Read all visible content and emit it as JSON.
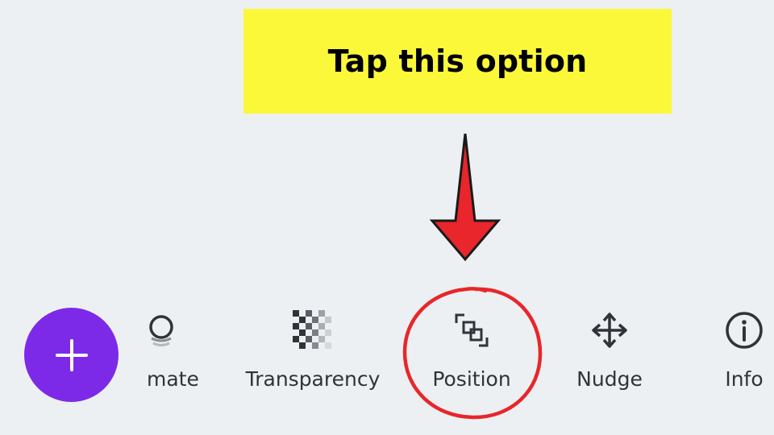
{
  "callout": {
    "text": "Tap this option"
  },
  "toolbar": {
    "add_button": {
      "icon": "plus-icon"
    },
    "items": [
      {
        "label": "mate",
        "icon": "animate-icon"
      },
      {
        "label": "Transparency",
        "icon": "transparency-icon"
      },
      {
        "label": "Position",
        "icon": "position-icon"
      },
      {
        "label": "Nudge",
        "icon": "move-arrows-icon"
      },
      {
        "label": "Info",
        "icon": "info-icon"
      }
    ]
  },
  "colors": {
    "background": "#edf0f2",
    "callout_background": "#fbf83a",
    "accent_purple": "#7d2ae8",
    "annotation_red": "#e8262b",
    "label_text": "#2f343a"
  }
}
